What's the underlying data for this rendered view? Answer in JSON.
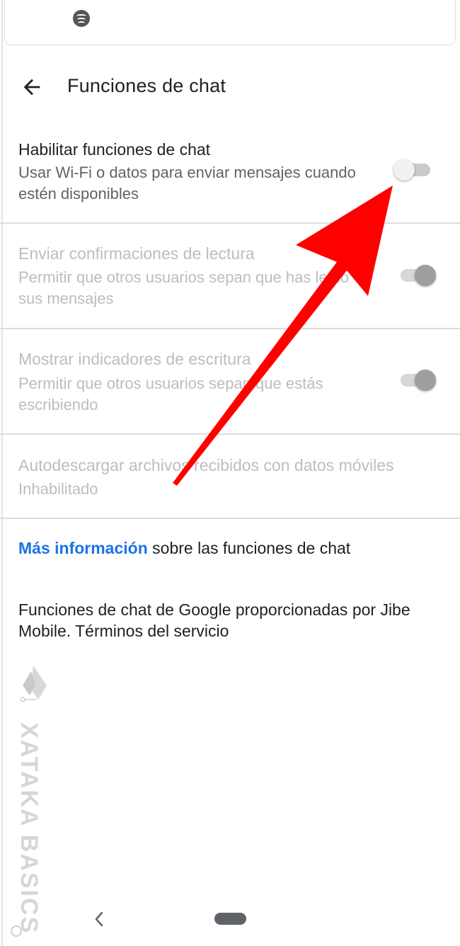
{
  "header": {
    "title": "Funciones de chat",
    "back_icon": "arrow-left-icon"
  },
  "top_card": {
    "icon": "spotify-icon"
  },
  "settings": [
    {
      "title": "Habilitar funciones de chat",
      "description": "Usar Wi-Fi o datos para enviar mensajes cuando estén disponibles",
      "enabled": true,
      "switch_on": false
    },
    {
      "title": "Enviar confirmaciones de lectura",
      "description": "Permitir que otros usuarios sepan que has leído sus mensajes",
      "enabled": false,
      "switch_on": true
    },
    {
      "title": "Mostrar indicadores de escritura",
      "description": "Permitir que otros usuarios sepan que estás escribiendo",
      "enabled": false,
      "switch_on": true
    },
    {
      "title": "Autodescargar archivos recibidos con datos móviles",
      "description": "Inhabilitado",
      "enabled": false
    }
  ],
  "info": {
    "link_text": "Más información",
    "rest_text": " sobre las funciones de chat"
  },
  "footer": {
    "text": "Funciones de chat de Google proporcionadas por Jibe Mobile. Términos del servicio"
  },
  "watermark": {
    "text": "XATAKA BASICS",
    "logo_icon": "xataka-logo-icon"
  },
  "navbar": {
    "back_icon": "nav-back-icon",
    "home_icon": "home-pill-icon"
  },
  "colors": {
    "link": "#1a73e8",
    "text_primary": "#202124",
    "text_secondary": "#5f6368",
    "text_disabled": "#bdbdbd",
    "annotation_arrow": "#ff0000"
  }
}
